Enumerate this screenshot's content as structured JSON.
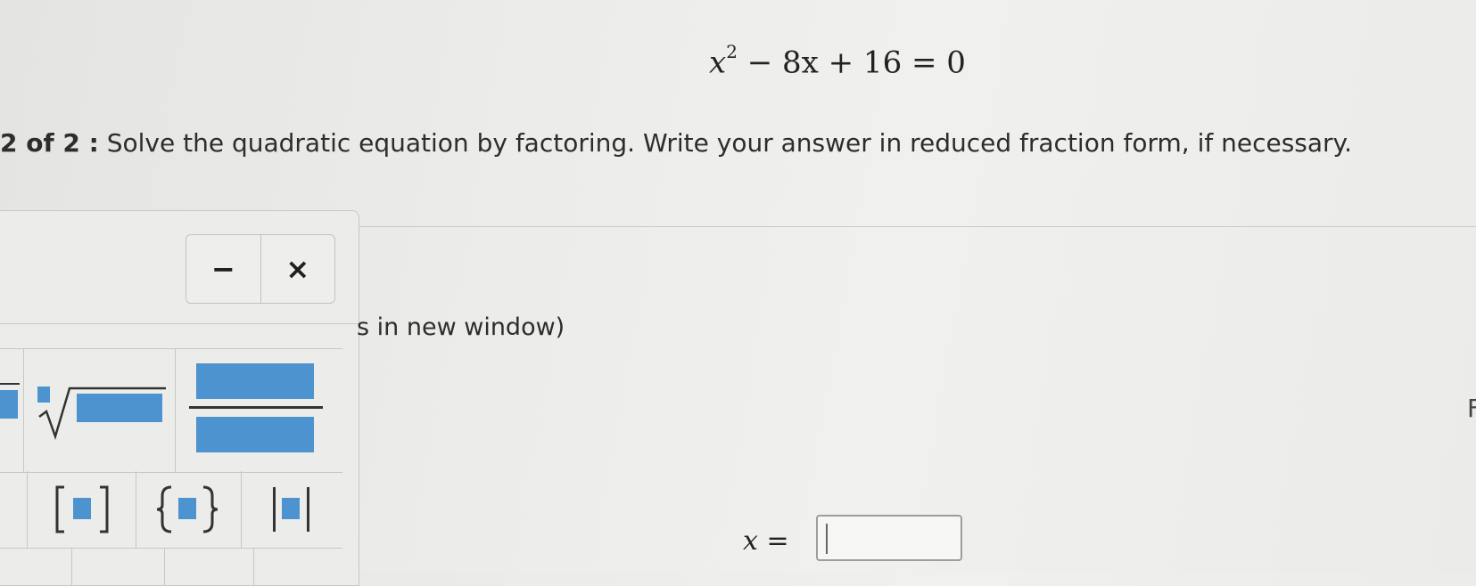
{
  "problem": {
    "eq_var": "x",
    "eq_exponent": "2",
    "eq_rest": " − 8x + 16 = 0",
    "step": "2 of 2 :",
    "instruction": "Solve the quadratic equation by factoring. Write your answer in reduced fraction form, if necessary."
  },
  "palette": {
    "minimize_label": "−",
    "close_label": "×"
  },
  "link": {
    "new_window_text": "s in new window)"
  },
  "answer": {
    "var": "x",
    "equals": " =",
    "value": ""
  },
  "edge_text": "F",
  "colors": {
    "tool_blue": "#4c93cf",
    "background": "#ececea"
  },
  "icons": [
    "nth-root-icon",
    "fraction-icon",
    "square-brackets-icon",
    "curly-braces-icon",
    "absolute-value-icon"
  ]
}
